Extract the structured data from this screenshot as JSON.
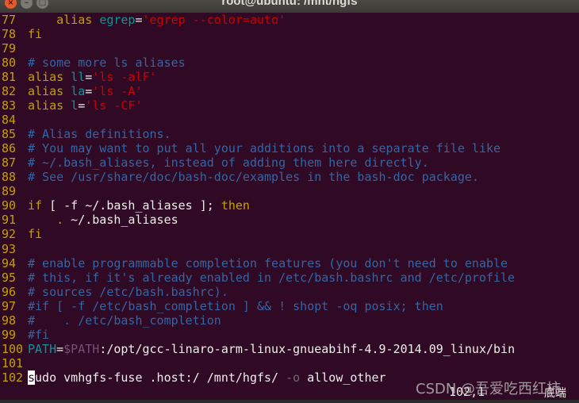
{
  "window": {
    "title": "root@ubuntu: /mnt/hgfs",
    "close": "×",
    "minimize": "–",
    "maximize": "□"
  },
  "colors": {
    "background": "#300a24",
    "line_number": "#c4a000",
    "keyword": "#c4a000",
    "comment": "#3465a4",
    "string": "#cc0000",
    "identifier": "#06989a",
    "variable": "#75507b"
  },
  "lines": [
    {
      "n": "77",
      "tokens": [
        [
          "",
          "    "
        ],
        [
          "kw",
          "alias"
        ],
        [
          "",
          " "
        ],
        [
          "id",
          "egrep"
        ],
        [
          "",
          "="
        ],
        [
          "str",
          "'egrep --color=auto'"
        ]
      ]
    },
    {
      "n": "78",
      "tokens": [
        [
          "kw",
          "fi"
        ]
      ]
    },
    {
      "n": "79",
      "tokens": []
    },
    {
      "n": "80",
      "tokens": [
        [
          "cm",
          "# some more ls aliases"
        ]
      ]
    },
    {
      "n": "81",
      "tokens": [
        [
          "kw",
          "alias"
        ],
        [
          "",
          " "
        ],
        [
          "id",
          "ll"
        ],
        [
          "",
          "="
        ],
        [
          "str",
          "'ls -alF'"
        ]
      ]
    },
    {
      "n": "82",
      "tokens": [
        [
          "kw",
          "alias"
        ],
        [
          "",
          " "
        ],
        [
          "id",
          "la"
        ],
        [
          "",
          "="
        ],
        [
          "str",
          "'ls -A'"
        ]
      ]
    },
    {
      "n": "83",
      "tokens": [
        [
          "kw",
          "alias"
        ],
        [
          "",
          " "
        ],
        [
          "id",
          "l"
        ],
        [
          "",
          "="
        ],
        [
          "str",
          "'ls -CF'"
        ]
      ]
    },
    {
      "n": "84",
      "tokens": []
    },
    {
      "n": "85",
      "tokens": [
        [
          "cm",
          "# Alias definitions."
        ]
      ]
    },
    {
      "n": "86",
      "tokens": [
        [
          "cm",
          "# You may want to put all your additions into a separate file like"
        ]
      ]
    },
    {
      "n": "87",
      "tokens": [
        [
          "cm",
          "# ~/.bash_aliases, instead of adding them here directly."
        ]
      ]
    },
    {
      "n": "88",
      "tokens": [
        [
          "cm",
          "# See /usr/share/doc/bash-doc/examples in the bash-doc package."
        ]
      ]
    },
    {
      "n": "89",
      "tokens": []
    },
    {
      "n": "90",
      "tokens": [
        [
          "kw",
          "if"
        ],
        [
          "",
          " [ -f ~/.bash_aliases ]; "
        ],
        [
          "kw",
          "then"
        ]
      ]
    },
    {
      "n": "91",
      "tokens": [
        [
          "",
          "    "
        ],
        [
          "kw",
          "."
        ],
        [
          "",
          " ~/.bash_aliases"
        ]
      ]
    },
    {
      "n": "92",
      "tokens": [
        [
          "kw",
          "fi"
        ]
      ]
    },
    {
      "n": "93",
      "tokens": []
    },
    {
      "n": "94",
      "tokens": [
        [
          "cm",
          "# enable programmable completion features (you don't need to enable"
        ]
      ]
    },
    {
      "n": "95",
      "tokens": [
        [
          "cm",
          "# this, if it's already enabled in /etc/bash.bashrc and /etc/profile"
        ]
      ]
    },
    {
      "n": "96",
      "tokens": [
        [
          "cm",
          "# sources /etc/bash.bashrc)."
        ]
      ]
    },
    {
      "n": "97",
      "tokens": [
        [
          "cm",
          "#if [ -f /etc/bash_completion ] && ! shopt -oq posix; then"
        ]
      ]
    },
    {
      "n": "98",
      "tokens": [
        [
          "cm",
          "#    . /etc/bash_completion"
        ]
      ]
    },
    {
      "n": "99",
      "tokens": [
        [
          "cm",
          "#fi"
        ]
      ]
    },
    {
      "n": "100",
      "tokens": [
        [
          "id",
          "PATH"
        ],
        [
          "",
          "="
        ],
        [
          "var",
          "$PATH"
        ],
        [
          "",
          ":/opt/gcc-linaro-arm-linux-gnueabihf-4.9-2014.09_linux/bin"
        ]
      ]
    },
    {
      "n": "101",
      "tokens": []
    },
    {
      "n": "102",
      "tokens": [
        [
          "cur",
          "s"
        ],
        [
          "",
          "udo vmhgfs-fuse .host:/ /mnt/hgfs/ "
        ],
        [
          "opt",
          "-o"
        ],
        [
          "",
          " allow_other"
        ]
      ]
    }
  ],
  "status": {
    "position": "102,1",
    "scroll": "底端"
  },
  "watermark": "CSDN @吾爱吃西红柿"
}
